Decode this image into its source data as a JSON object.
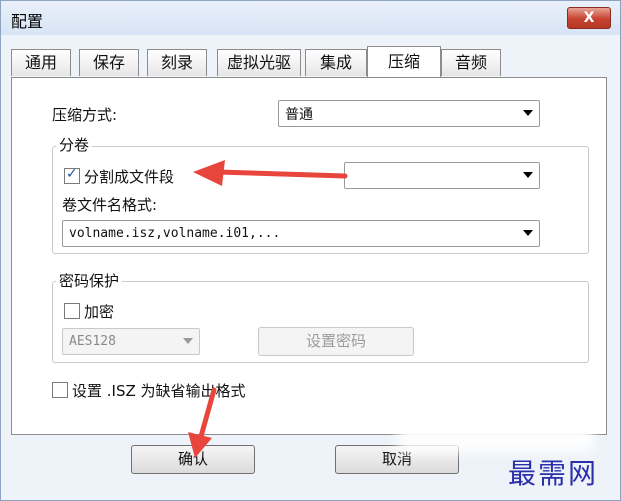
{
  "window": {
    "title": "配置",
    "close_glyph": "X"
  },
  "tabs": [
    "通用",
    "保存",
    "刻录",
    "虚拟光驱",
    "集成",
    "压缩",
    "音频"
  ],
  "compression": {
    "method_label": "压缩方式:",
    "method_value": "普通",
    "split_group": {
      "title": "分卷",
      "split_label": "分割成文件段",
      "split_checked": true,
      "split_size_value": "",
      "name_format_label": "卷文件名格式:",
      "name_format_value": "volname.isz,volname.i01,..."
    },
    "password_group": {
      "title": "密码保护",
      "encrypt_label": "加密",
      "encrypt_checked": false,
      "algorithm_value": "AES128",
      "set_password_label": "设置密码"
    },
    "default_format_label": "设置 .ISZ 为缺省输出格式"
  },
  "buttons": {
    "ok": "确认",
    "cancel": "取消"
  },
  "watermark": "最需网",
  "colors": {
    "annotation_arrow": "#e8453c",
    "watermark": "#2a2faa"
  }
}
